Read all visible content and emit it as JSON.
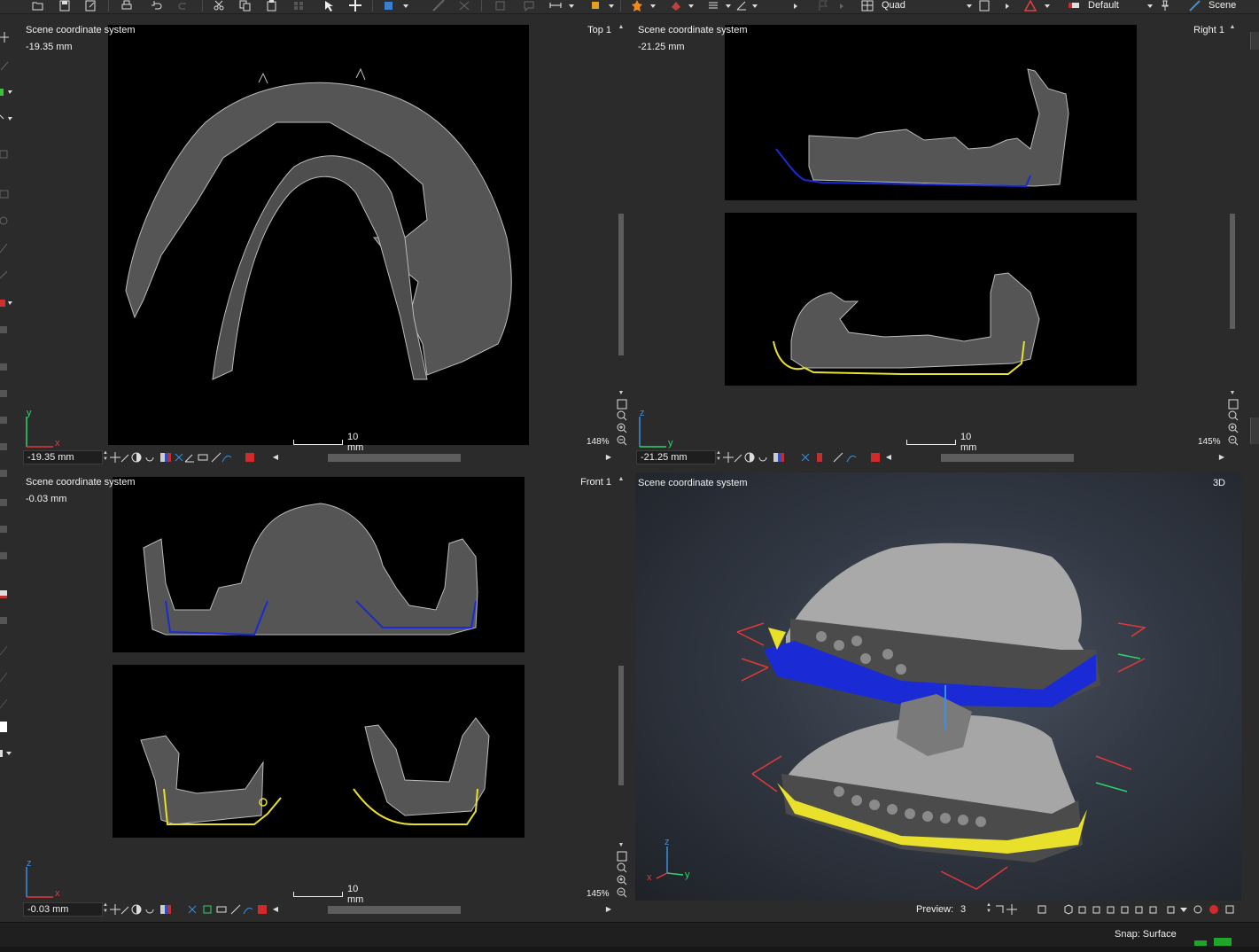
{
  "toolbar": {
    "layout_label": "Quad",
    "preset_label": "Default",
    "scene_label": "Scene"
  },
  "viewports": {
    "top": {
      "coord_system": "Scene coordinate system",
      "offset_readout": "-19.35 mm",
      "name": "Top 1",
      "zoom": "148%",
      "scale_label": "10 mm",
      "coord_input": "-19.35 mm",
      "axis_h": "x",
      "axis_v": "y"
    },
    "right": {
      "coord_system": "Scene coordinate system",
      "offset_readout": "-21.25 mm",
      "name": "Right 1",
      "zoom": "145%",
      "scale_label": "10 mm",
      "coord_input": "-21.25 mm",
      "axis_h": "y",
      "axis_v": "z"
    },
    "front": {
      "coord_system": "Scene coordinate system",
      "offset_readout": "-0.03 mm",
      "name": "Front 1",
      "zoom": "145%",
      "scale_label": "10 mm",
      "coord_input": "-0.03 mm",
      "axis_h": "x",
      "axis_v": "z"
    },
    "three_d": {
      "coord_system": "Scene coordinate system",
      "name": "3D",
      "preview_label": "Preview:",
      "preview_value": "3",
      "axis_x": "x",
      "axis_y": "y",
      "axis_z": "z"
    }
  },
  "status": {
    "snap": "Snap: Surface"
  },
  "colors": {
    "background": "#2b2b2b",
    "image_bg": "#000000",
    "tissue_gray": "#5a5a5a",
    "blue_contour": "#1a2bd6",
    "yellow_contour": "#e8e02a",
    "axis_x": "#e03a3a",
    "axis_y": "#2fd36b",
    "axis_z": "#3a8fe0"
  }
}
